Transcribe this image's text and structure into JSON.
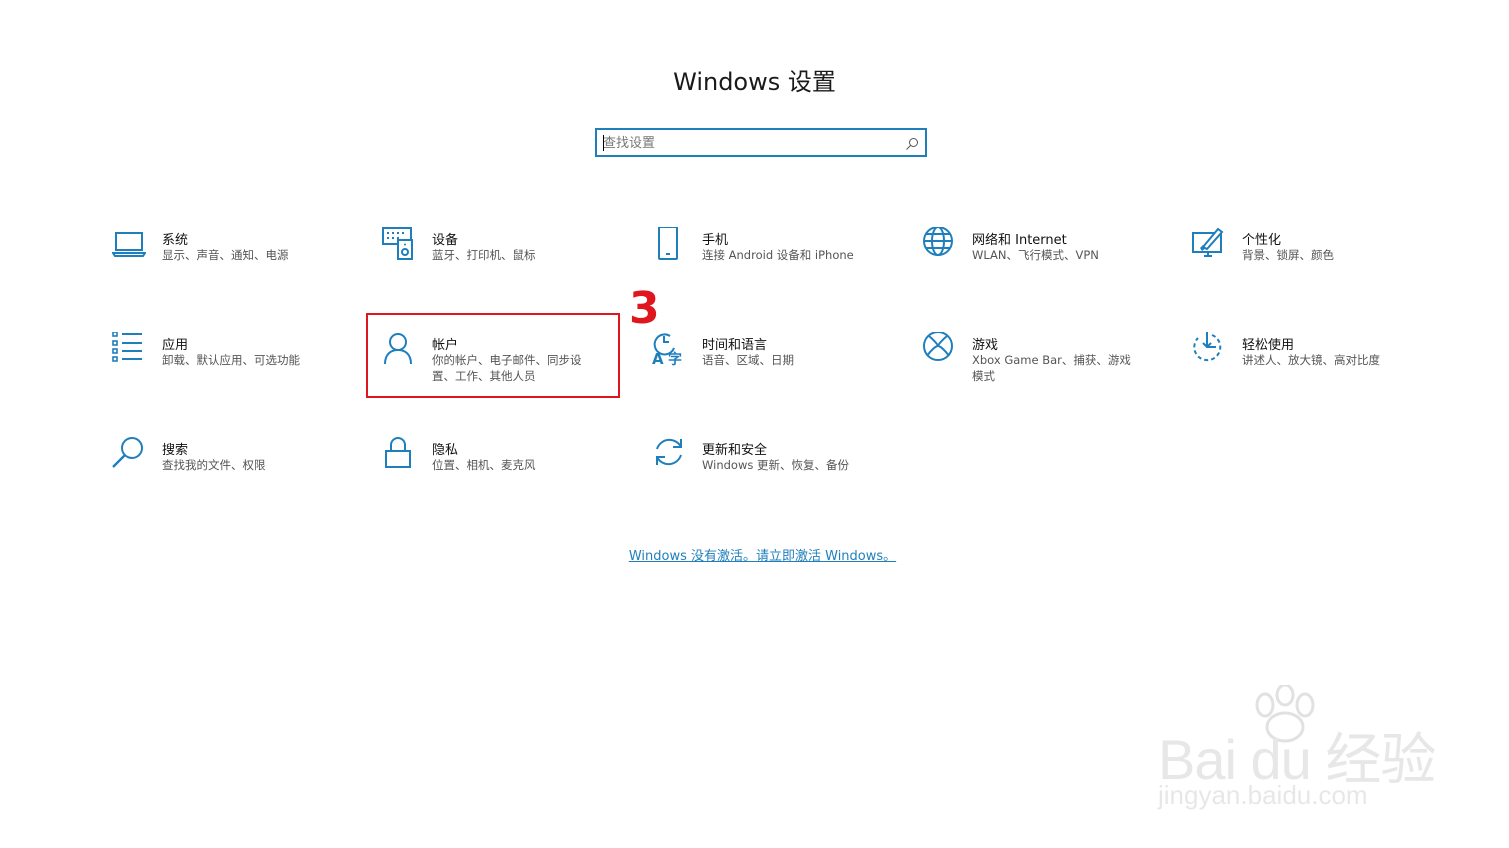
{
  "window_title": "Windows 设置",
  "search": {
    "placeholder": "查找设置"
  },
  "tiles": [
    {
      "name": "系统",
      "desc": "显示、声音、通知、电源",
      "icon": "laptop-icon"
    },
    {
      "name": "设备",
      "desc": "蓝牙、打印机、鼠标",
      "icon": "devices-icon"
    },
    {
      "name": "手机",
      "desc": "连接 Android 设备和 iPhone",
      "icon": "phone-icon"
    },
    {
      "name": "网络和 Internet",
      "desc": "WLAN、飞行模式、VPN",
      "icon": "globe-icon"
    },
    {
      "name": "个性化",
      "desc": "背景、锁屏、颜色",
      "icon": "personalization-icon"
    },
    {
      "name": "应用",
      "desc": "卸载、默认应用、可选功能",
      "icon": "apps-list-icon"
    },
    {
      "name": "帐户",
      "desc": "你的帐户、电子邮件、同步设置、工作、其他人员",
      "icon": "person-icon"
    },
    {
      "name": "时间和语言",
      "desc": "语音、区域、日期",
      "icon": "time-language-icon"
    },
    {
      "name": "游戏",
      "desc": "Xbox Game Bar、捕获、游戏模式",
      "icon": "xbox-icon"
    },
    {
      "name": "轻松使用",
      "desc": "讲述人、放大镜、高对比度",
      "icon": "ease-of-access-icon"
    },
    {
      "name": "搜索",
      "desc": "查找我的文件、权限",
      "icon": "search-icon"
    },
    {
      "name": "隐私",
      "desc": "位置、相机、麦克风",
      "icon": "lock-icon"
    },
    {
      "name": "更新和安全",
      "desc": "Windows 更新、恢复、备份",
      "icon": "update-icon"
    }
  ],
  "annotation": {
    "step_number": "3"
  },
  "activate_link": "Windows 没有激活。请立即激活 Windows。",
  "watermark": {
    "brand": "Bai du 经验",
    "url": "jingyan.baidu.com"
  },
  "colors": {
    "accent": "#1f7fbd",
    "highlight": "#e0161e"
  }
}
